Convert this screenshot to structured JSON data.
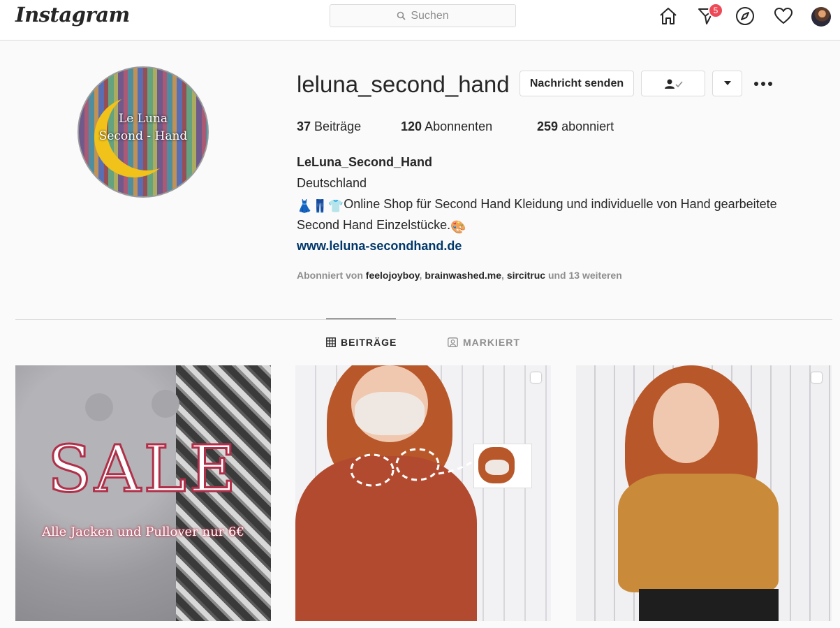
{
  "nav": {
    "logo": "Instagram",
    "search_placeholder": "Suchen",
    "notification_count": "5"
  },
  "profile": {
    "username": "leluna_second_hand",
    "message_button": "Nachricht senden",
    "stats": {
      "posts_count": "37",
      "posts_label": "Beiträge",
      "followers_count": "120",
      "followers_label": "Abonnenten",
      "following_count": "259",
      "following_label": "abonniert"
    },
    "avatar_text": {
      "line1": "Le Luna",
      "line2": "Second - Hand"
    },
    "bio": {
      "name": "LeLuna_Second_Hand",
      "location": "Deutschland",
      "line1_emojis": "👗👖👕",
      "line1_text": "Online Shop für Second Hand Kleidung und individuelle von Hand gearbeitete",
      "line2_text": "Second Hand Einzelstücke.",
      "line2_emoji": "🎨",
      "website": "www.leluna-secondhand.de"
    },
    "followed_by": {
      "prefix": "Abonniert von",
      "accounts": [
        "feelojoyboy",
        "brainwashed.me",
        "sircitruc"
      ],
      "suffix": "und 13 weiteren"
    }
  },
  "tabs": {
    "posts": "BEITRÄGE",
    "tagged": "MARKIERT"
  },
  "posts": {
    "post1_title": "SALE",
    "post1_subtitle": "Alle Jacken und Pullover nur 6€"
  }
}
